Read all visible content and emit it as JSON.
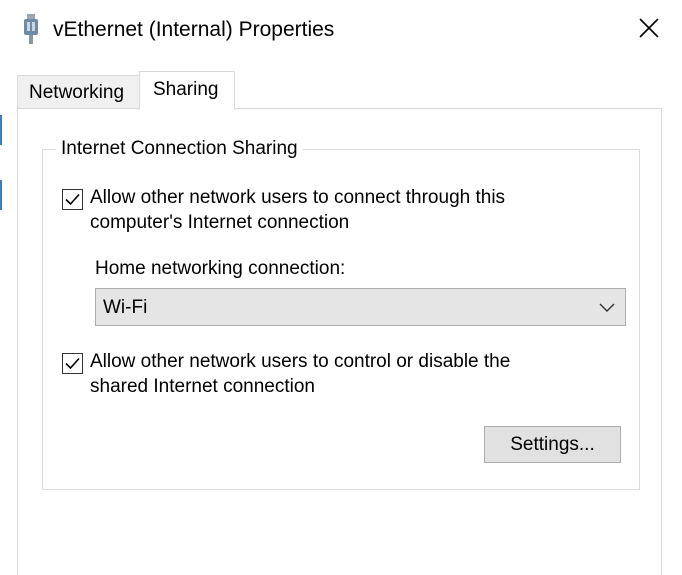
{
  "window": {
    "title": "vEthernet (Internal) Properties",
    "icon": "network-adapter-icon",
    "close_icon": "close-icon"
  },
  "tabs": [
    {
      "label": "Networking",
      "selected": false
    },
    {
      "label": "Sharing",
      "selected": true
    }
  ],
  "ics": {
    "group_title": "Internet Connection Sharing",
    "allow_connect": {
      "checked": true,
      "label": "Allow other network users to connect through this computer's Internet connection"
    },
    "home_label": "Home networking connection:",
    "home_value": "Wi-Fi",
    "allow_control": {
      "checked": true,
      "label": "Allow other network users to control or disable the shared Internet connection"
    },
    "settings_label": "Settings..."
  },
  "colors": {
    "tab_border": "#d9d9d9",
    "button_face": "#e1e1e1",
    "combo_face": "#e5e5e5"
  }
}
